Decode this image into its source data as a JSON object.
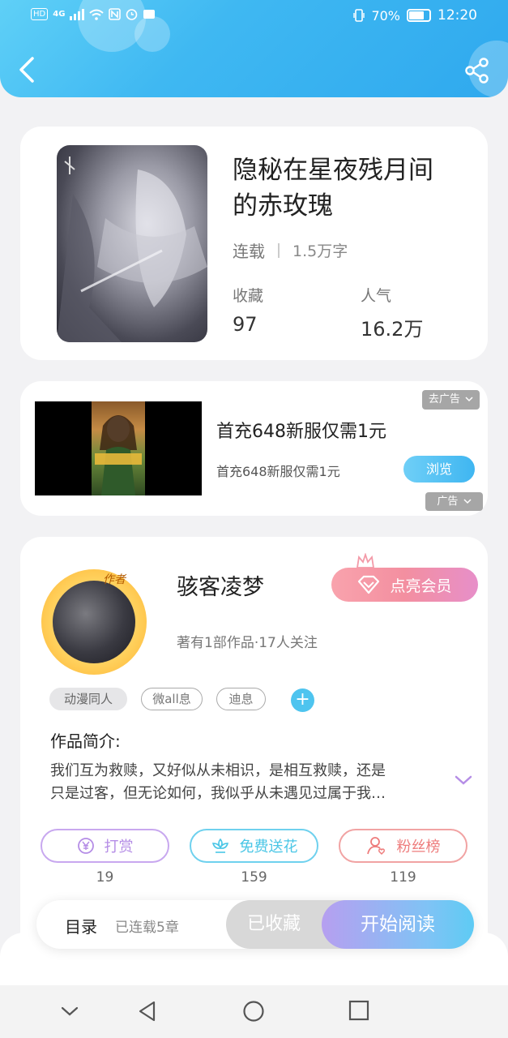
{
  "status": {
    "network": "HD",
    "signal": "4G",
    "battery_pct": "70%",
    "time": "12:20"
  },
  "header": {
    "back_icon": "chevron-left-icon",
    "share_icon": "share-icon"
  },
  "book": {
    "title_line1": "隐秘在星夜残月间",
    "title_line2": "的赤玫瑰",
    "status": "连载",
    "word_count": "1.5万字",
    "favorites_label": "收藏",
    "favorites_value": "97",
    "popularity_label": "人气",
    "popularity_value": "16.2万"
  },
  "ad": {
    "title": "首充648新服仅需1元",
    "subtitle": "首充648新服仅需1元",
    "browse_label": "浏览",
    "remove_label": "去广告",
    "ad_label": "广告"
  },
  "author": {
    "badge": "作者",
    "name": "骇客凌梦",
    "info": "著有1部作品·17人关注",
    "vip_label": "点亮会员",
    "tags": [
      "动漫同人",
      "微all息",
      "迪息"
    ],
    "intro_title": "作品简介:",
    "intro_line1": "我们互为救赎，又好似从未相识，是相互救赎，还是",
    "intro_line2": "只是过客，但无论如何，我似乎从未遇见过属于我…",
    "actions": {
      "reward_label": "打赏",
      "reward_count": "19",
      "flower_label": "免费送花",
      "flower_count": "159",
      "fans_label": "粉丝榜",
      "fans_count": "119"
    }
  },
  "bottom": {
    "toc_label": "目录",
    "toc_status": "已连载5章",
    "collected_label": "已收藏",
    "read_label": "开始阅读"
  },
  "colors": {
    "header_blue": "#3fb8f2",
    "accent_cyan": "#4ec4ef",
    "reward_purple": "#b58de6",
    "flower_cyan": "#4ac6e6",
    "fans_red": "#ee7c7c"
  }
}
